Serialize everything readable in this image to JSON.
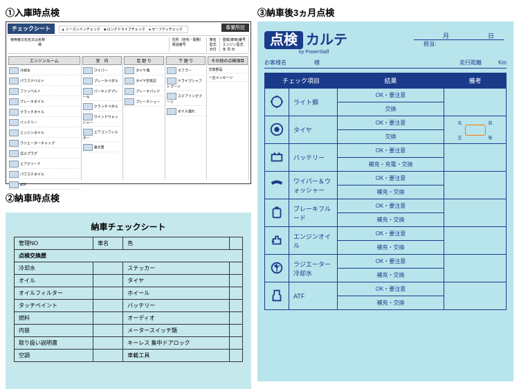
{
  "headings": {
    "h1": "①入庫時点検",
    "h2": "②納車時点検",
    "h3": "③納車後3ヵ月点検"
  },
  "sheet1": {
    "title": "チェックシート",
    "badge": "事業所控",
    "legend": {
      "a": "▲ シーズンインチェック",
      "b": "■ ロングドライブチェック",
      "c": "● セーフティチェック"
    },
    "meta": {
      "name_lbl": "使用者の氏名又は名称",
      "sama": "様",
      "addr_lbl": "住所（自宅・勤務）",
      "tel_lbl": "電話番号",
      "carname_lbl": "車名",
      "carno_lbl": "登録(車両)番号",
      "type_lbl": "型式",
      "engine_lbl": "エンジン型式",
      "date_lbl": "日付",
      "y": "年",
      "m": "月",
      "d": "日"
    },
    "cols": {
      "engine": "エンジンルーム",
      "interior": "室　内",
      "foot": "足 廻 り",
      "under": "下 廻 り",
      "other": "その他の点検項目"
    },
    "engine_items": [
      "冷却水",
      "パワステベルト",
      "ファンベルト",
      "ブレーキオイル",
      "クラッチオイル",
      "バッテリー",
      "エンジンオイル",
      "ラジエーターキャップ",
      "点火プラグ",
      "エアクリーナ",
      "パワステオイル",
      "ATF"
    ],
    "interior_items": [
      "ワイパー",
      "ブレーキペダル",
      "パーキングブレーキ",
      "クラッチペダル",
      "ウインドウォッシャー",
      "エアコンフィルター",
      "発炎筒"
    ],
    "foot_items": [
      "タイヤ溝",
      "タイヤ空気圧",
      "ブレーキパッド",
      "ブレーキシュー"
    ],
    "under_items": [
      "マフラー",
      "ドライブシャフトブーツ",
      "ステアリングブーツ",
      "オイル漏れ"
    ],
    "other_lbl": "交換部品",
    "msg_lbl": "一言メッセージ"
  },
  "sheet2": {
    "title": "納車チェックシート",
    "hdr": {
      "no": "管理NO",
      "car": "車名",
      "color": "色"
    },
    "sub": "点検交換歴",
    "rows": [
      [
        "冷却水",
        "ステッカー"
      ],
      [
        "オイル",
        "タイヤ"
      ],
      [
        "オイルフィルター",
        "ホイール"
      ],
      [
        "タッチペイント",
        "バッテリー"
      ],
      [
        "燃料",
        "オーディオ"
      ],
      [
        "内装",
        "メータースイッチ類"
      ],
      [
        "取り扱い説明書",
        "キーレス 集中ドアロック"
      ],
      [
        "空調",
        "車載工具"
      ]
    ]
  },
  "karte": {
    "logo_box": "点検",
    "logo_text": "カルテ",
    "by": "by PowerStaff",
    "date": {
      "m": "月",
      "d": "日"
    },
    "tanto": "担当:",
    "meta": {
      "name": "お客様名",
      "sama": "様",
      "odo": "走行距離",
      "km": "Km"
    },
    "th": {
      "item": "チェック項目",
      "result": "結果",
      "note": "備考"
    },
    "res": {
      "ok": "OK・要注意",
      "ex": "交換",
      "chg": "補充・充電・交換",
      "fill": "補充・交換"
    },
    "items": [
      {
        "name": "ライト類",
        "r1": "ok",
        "r2": "ex"
      },
      {
        "name": "タイヤ",
        "r1": "ok",
        "r2": "ex",
        "diag": true
      },
      {
        "name": "バッテリー",
        "r1": "ok",
        "r2": "chg"
      },
      {
        "name": "ワイパー＆ウォッシャー",
        "r1": "ok",
        "r2": "fill"
      },
      {
        "name": "ブレーキフルード",
        "r1": "ok",
        "r2": "fill"
      },
      {
        "name": "エンジンオイル",
        "r1": "ok",
        "r2": "fill"
      },
      {
        "name": "ラジエーター冷却水",
        "r1": "ok",
        "r2": "fill"
      },
      {
        "name": "ATF",
        "r1": "ok",
        "r2": "fill"
      }
    ],
    "diag": {
      "rf": "右",
      "lf": "左",
      "fr": "前",
      "rr": "後"
    }
  }
}
